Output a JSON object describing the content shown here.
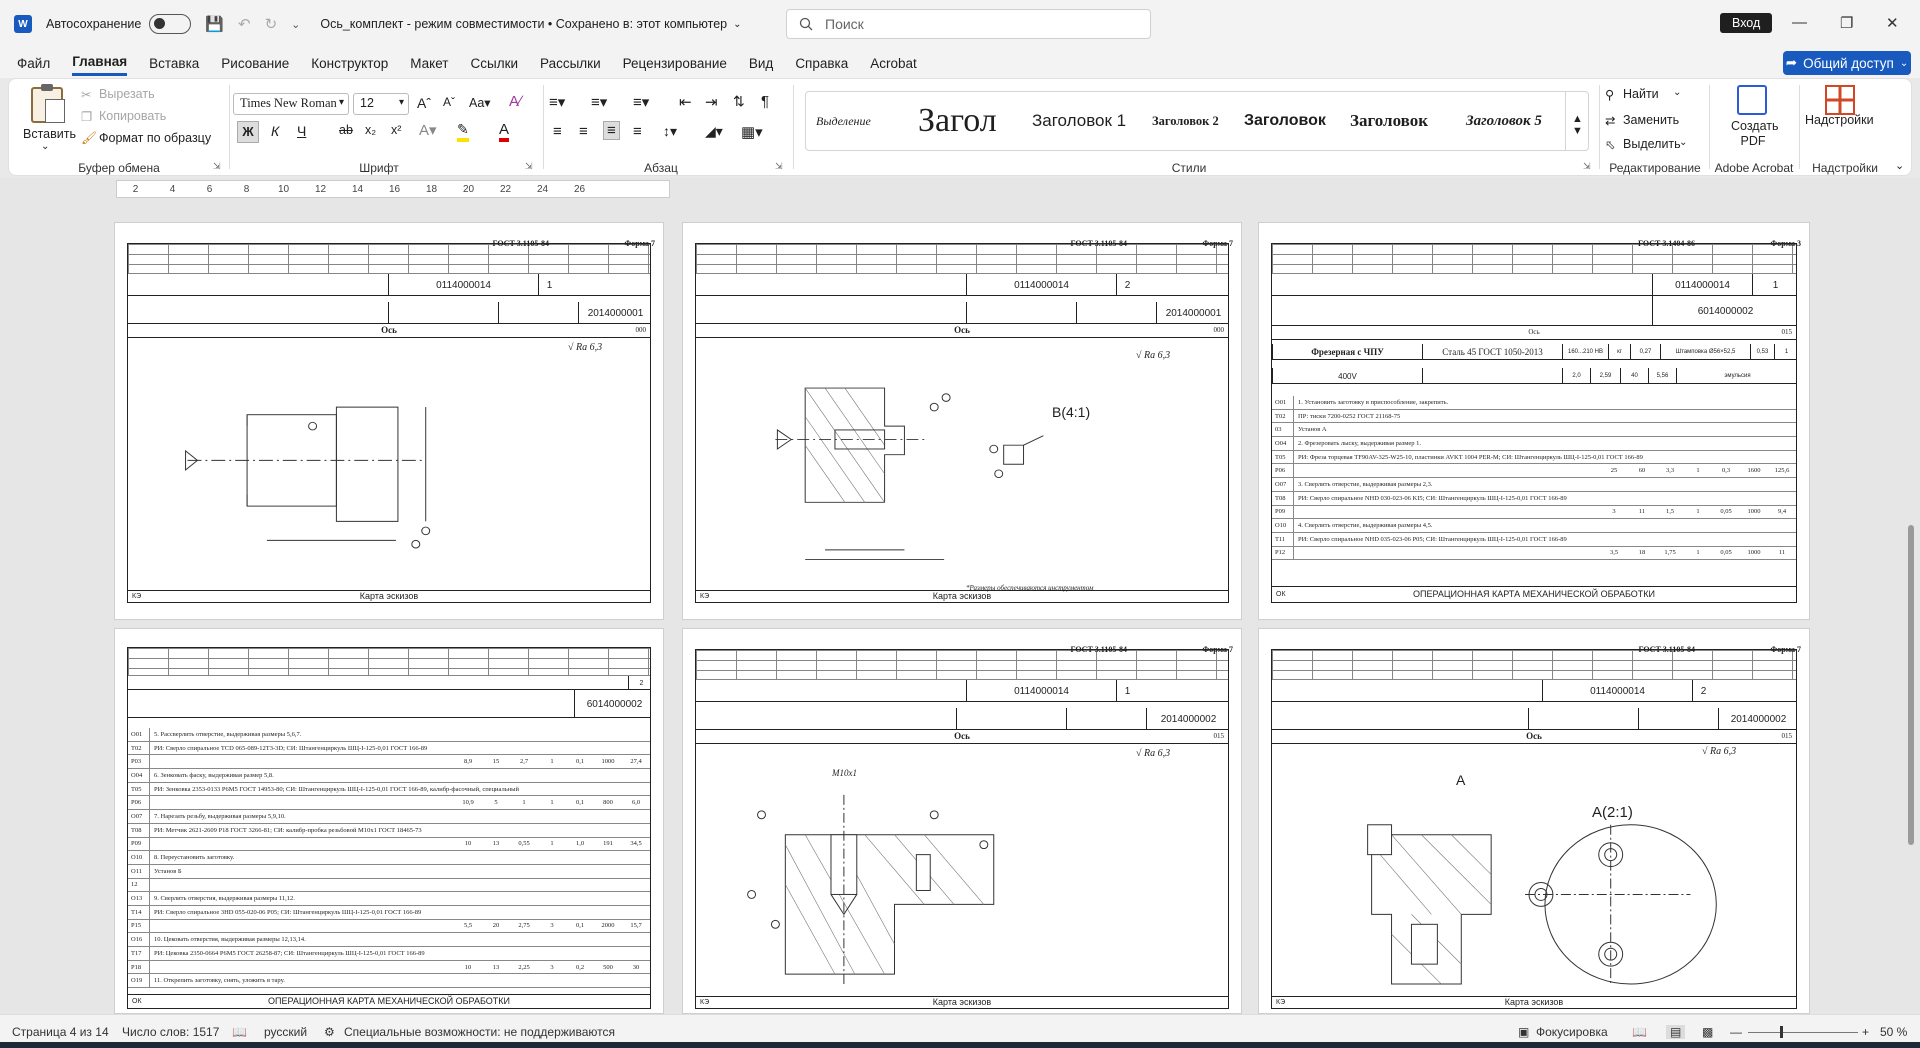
{
  "titlebar": {
    "autosave_label": "Автосохранение",
    "doc_title": "Ось_комплект  -  режим совместимости • Сохранено в: этот компьютер",
    "search_placeholder": "Поиск",
    "signin_label": "Вход"
  },
  "menu": {
    "items": [
      "Файл",
      "Главная",
      "Вставка",
      "Рисование",
      "Конструктор",
      "Макет",
      "Ссылки",
      "Рассылки",
      "Рецензирование",
      "Вид",
      "Справка",
      "Acrobat"
    ],
    "active": "Главная",
    "share_label": "Общий доступ"
  },
  "ribbon": {
    "clipboard": {
      "paste": "Вставить",
      "cut": "Вырезать",
      "copy": "Копировать",
      "format_painter": "Формат по образцу",
      "label": "Буфер обмена"
    },
    "font": {
      "family": "Times New Roman",
      "size": "12",
      "label": "Шрифт",
      "bold": "Ж",
      "italic": "К",
      "underline": "Ч",
      "strike": "ab",
      "sub": "x₂",
      "sup": "x²"
    },
    "paragraph": {
      "label": "Абзац"
    },
    "styles": {
      "label": "Стили",
      "items": [
        "Выделение",
        "Загол",
        "Заголовок 1",
        "Заголовок 2",
        "Заголовок 3",
        "Заголовок",
        "Заголовок 5"
      ]
    },
    "editing": {
      "find": "Найти",
      "replace": "Заменить",
      "select": "Выделить",
      "label": "Редактирование"
    },
    "acrobat": {
      "create_pdf": "Создать PDF",
      "label": "Adobe Acrobat"
    },
    "addins": {
      "button": "Надстройки",
      "label": "Надстройки"
    }
  },
  "ruler": {
    "ticks": [
      "2",
      "4",
      "6",
      "8",
      "10",
      "12",
      "14",
      "16",
      "18",
      "20",
      "22",
      "24",
      "26"
    ]
  },
  "pages": [
    {
      "gost": "ГОСТ 3.1105-84",
      "forma": "Форма 7",
      "code1": "0114000014",
      "code2": "2014000001",
      "sheet": "1",
      "title": "Ось",
      "sheet_total": "000",
      "ra": "√ Ra 6,3",
      "footer": "Карта эскизов",
      "footer_left": "КЭ"
    },
    {
      "gost": "ГОСТ 3.1105-84",
      "forma": "Форма 7",
      "code1": "0114000014",
      "code2": "2014000001",
      "sheet": "2",
      "title": "Ось",
      "sheet_total": "000",
      "ra": "√ Ra 6,3",
      "view_label": "B(4:1)",
      "note": "*Размеры обеспечиваются инструментом",
      "footer": "Карта эскизов",
      "footer_left": "КЭ"
    },
    {
      "gost": "ГОСТ 3.1404-86",
      "forma": "Форма 3",
      "code1": "0114000014",
      "code2": "6014000002",
      "sheet": "1",
      "title": "Ось",
      "sheet_total": "015",
      "op_name": "Фрезерная с ЧПУ",
      "material": "Сталь 45 ГОСТ 1050-2013",
      "hardness": "160...210 HB",
      "unit": "кг",
      "mass": "0,27",
      "blank": "Штамповка Ø56×52,5",
      "kim": "0,53",
      "qty": "1",
      "equipment": "400V",
      "t1": "2,0",
      "t2": "2,59",
      "t3": "40",
      "t4": "5,56",
      "coolant": "эмульсия",
      "rows": [
        {
          "c": "О01",
          "t": "1. Установить заготовку в приспособление, закрепить."
        },
        {
          "c": "Т02",
          "t": "ПР: тиски 7200-0252 ГОСТ 21168-75"
        },
        {
          "c": "03",
          "t": "Установ А"
        },
        {
          "c": "О04",
          "t": "2. Фрезеровать лыску, выдерживая размер 1."
        },
        {
          "c": "Т05",
          "t": "РИ: Фреза торцевая TF90AV-325-W25-10, пластинки AVKT 1004 PER-M; СИ: Штангенциркуль ШЦ-I-125-0,01 ГОСТ 166-89"
        },
        {
          "c": "Р06",
          "t": "",
          "n": [
            "25",
            "60",
            "3,3",
            "1",
            "0,3",
            "1600",
            "125,6"
          ]
        },
        {
          "c": "О07",
          "t": "3. Сверлить отверстие, выдерживая размеры 2,3."
        },
        {
          "c": "Т08",
          "t": "РИ: Сверло спиральное NHD 030-023-06 KI5; СИ: Штангенциркуль ШЦ-I-125-0,01 ГОСТ 166-89"
        },
        {
          "c": "Р09",
          "t": "",
          "n": [
            "3",
            "11",
            "1,5",
            "1",
            "0,05",
            "1000",
            "9,4"
          ]
        },
        {
          "c": "О10",
          "t": "4. Сверлить отверстие, выдерживая размеры 4,5."
        },
        {
          "c": "Т11",
          "t": "РИ: Сверло спиральное NHD 035-023-06 P05; СИ: Штангенциркуль ШЦ-I-125-0,01 ГОСТ 166-89"
        },
        {
          "c": "Р12",
          "t": "",
          "n": [
            "3,5",
            "18",
            "1,75",
            "1",
            "0,05",
            "1000",
            "11"
          ]
        }
      ],
      "footer": "ОПЕРАЦИОННАЯ КАРТА МЕХАНИЧЕСКОЙ ОБРАБОТКИ",
      "footer_left": "ОК"
    },
    {
      "code2": "6014000002",
      "sheet": "2",
      "rows": [
        {
          "c": "О01",
          "t": "5. Рассверлить отверстие, выдерживая размеры 5,6,7."
        },
        {
          "c": "Т02",
          "t": "РИ: Сверло спиральное TCD 065-089-12T3-3D; СИ: Штангенциркуль ШЦ-I-125-0,01 ГОСТ 166-89"
        },
        {
          "c": "Р03",
          "t": "",
          "n": [
            "8,9",
            "15",
            "2,7",
            "1",
            "0,1",
            "1000",
            "27,4"
          ]
        },
        {
          "c": "О04",
          "t": "6. Зенковать фаску, выдерживая размер 5,8."
        },
        {
          "c": "Т05",
          "t": "РИ: Зенковка 2353-0133 Р6М5 ГОСТ 14953-80; СИ: Штангенциркуль ШЦ-I-125-0,01 ГОСТ 166-89, калибр-фасочный, специальный"
        },
        {
          "c": "Р06",
          "t": "",
          "n": [
            "10,9",
            "5",
            "1",
            "1",
            "0,1",
            "800",
            "6,0"
          ]
        },
        {
          "c": "О07",
          "t": "7. Нарезать резьбу, выдерживая размеры 5,9,10."
        },
        {
          "c": "Т08",
          "t": "РИ: Метчик 2621-2609 Р18 ГОСТ 3266-81; СИ: калибр-пробка резьбовой М10х1 ГОСТ 18465-73"
        },
        {
          "c": "Р09",
          "t": "",
          "n": [
            "10",
            "13",
            "0,55",
            "1",
            "1,0",
            "191",
            "34,5"
          ]
        },
        {
          "c": "О10",
          "t": "8. Переустановить заготовку."
        },
        {
          "c": "О11",
          "t": "Установ Б"
        },
        {
          "c": "12",
          "t": ""
        },
        {
          "c": "О13",
          "t": "9. Сверлить отверстия, выдерживая размеры 11,12."
        },
        {
          "c": "Т14",
          "t": "РИ: Сверло спиральное 3HD 055-020-06 P05; СИ: Штангенциркуль ШЦ-I-125-0,01 ГОСТ 166-89"
        },
        {
          "c": "Р15",
          "t": "",
          "n": [
            "5,5",
            "20",
            "2,75",
            "3",
            "0,1",
            "2000",
            "15,7"
          ]
        },
        {
          "c": "О16",
          "t": "10. Цековать отверстия, выдерживая размеры 12,13,14."
        },
        {
          "c": "Т17",
          "t": "РИ: Цековка 2350-0664 Р6М5 ГОСТ 26258-87; СИ: Штангенциркуль ШЦ-I-125-0,01 ГОСТ 166-89"
        },
        {
          "c": "Р18",
          "t": "",
          "n": [
            "10",
            "13",
            "2,25",
            "3",
            "0,2",
            "500",
            "30"
          ]
        },
        {
          "c": "О19",
          "t": "11. Открепить заготовку, снять, уложить в тару."
        }
      ],
      "footer": "ОПЕРАЦИОННАЯ КАРТА МЕХАНИЧЕСКОЙ ОБРАБОТКИ",
      "footer_left": "ОК"
    },
    {
      "gost": "ГОСТ 3.1105-84",
      "forma": "Форма 7",
      "code1": "0114000014",
      "code2": "2014000002",
      "sheet": "1",
      "title": "Ось",
      "sheet_total": "015",
      "ra": "√ Ra 6,3",
      "thread": "M10x1",
      "footer": "Карта эскизов",
      "footer_left": "КЭ"
    },
    {
      "gost": "ГОСТ 3.1105-84",
      "forma": "Форма 7",
      "code1": "0114000014",
      "code2": "2014000002",
      "sheet": "2",
      "title": "Ось",
      "sheet_total": "015",
      "ra": "√ Ra 6,3",
      "view_a": "A",
      "view_label": "A(2:1)",
      "footer": "Карта эскизов",
      "footer_left": "КЭ"
    }
  ],
  "status": {
    "page": "Страница 4 из 14",
    "words": "Число слов: 1517",
    "language": "русский",
    "accessibility": "Специальные возможности: не поддерживаются",
    "focus": "Фокусировка",
    "zoom": "50 %"
  }
}
